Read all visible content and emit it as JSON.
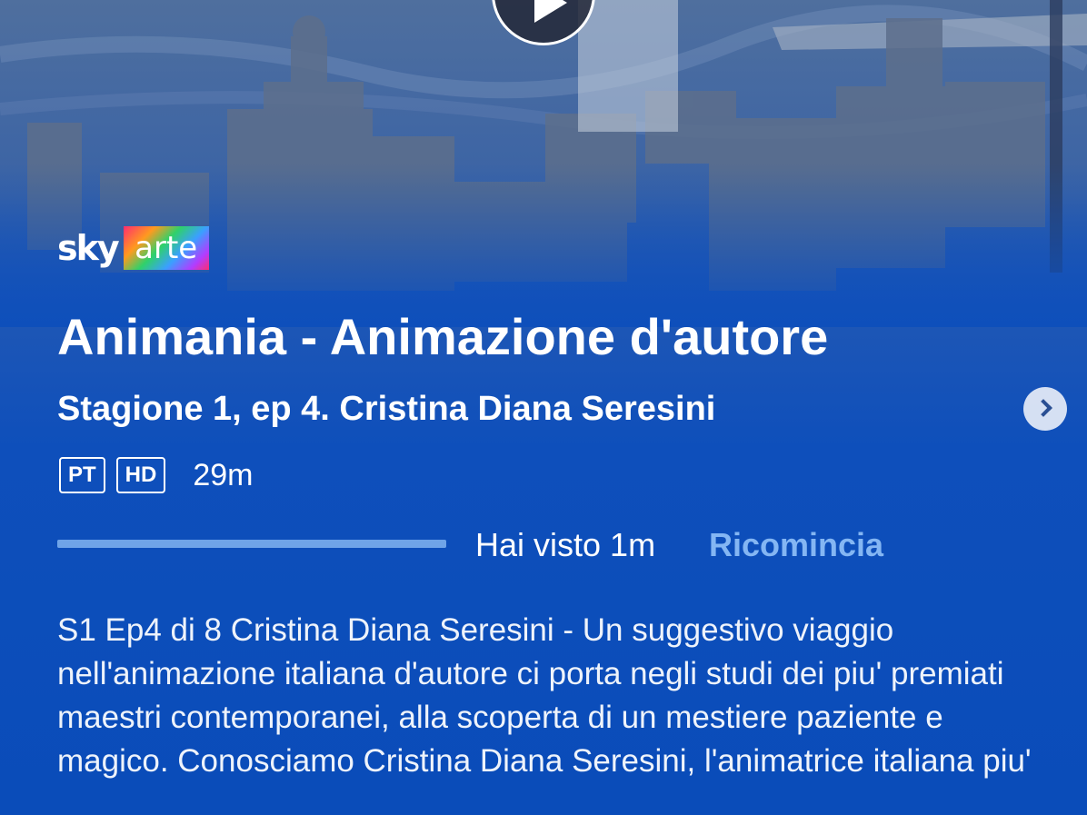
{
  "brand": {
    "sky": "sky",
    "channel": "arte"
  },
  "show": {
    "title": "Animania - Animazione d'autore",
    "subtitle": "Stagione 1, ep 4. Cristina Diana Seresini",
    "badges": [
      "PT",
      "HD"
    ],
    "duration": "29m"
  },
  "progress": {
    "fraction": 1,
    "watched_label": "Hai visto 1m",
    "restart_label": "Ricomincia"
  },
  "description": "S1 Ep4 di 8 Cristina Diana Seresini - Un suggestivo viaggio nell'animazione italiana d'autore ci porta negli studi dei piu' premiati maestri contemporanei, alla scoperta di un mestiere paziente e magico. Conosciamo Cristina Diana Seresini, l'animatrice italiana piu'",
  "icons": {
    "play": "play-icon",
    "next": "chevron-right-icon"
  },
  "colors": {
    "background": "#0c4fb8",
    "accent": "#84b6f3",
    "progress": "#6fa4e8"
  }
}
